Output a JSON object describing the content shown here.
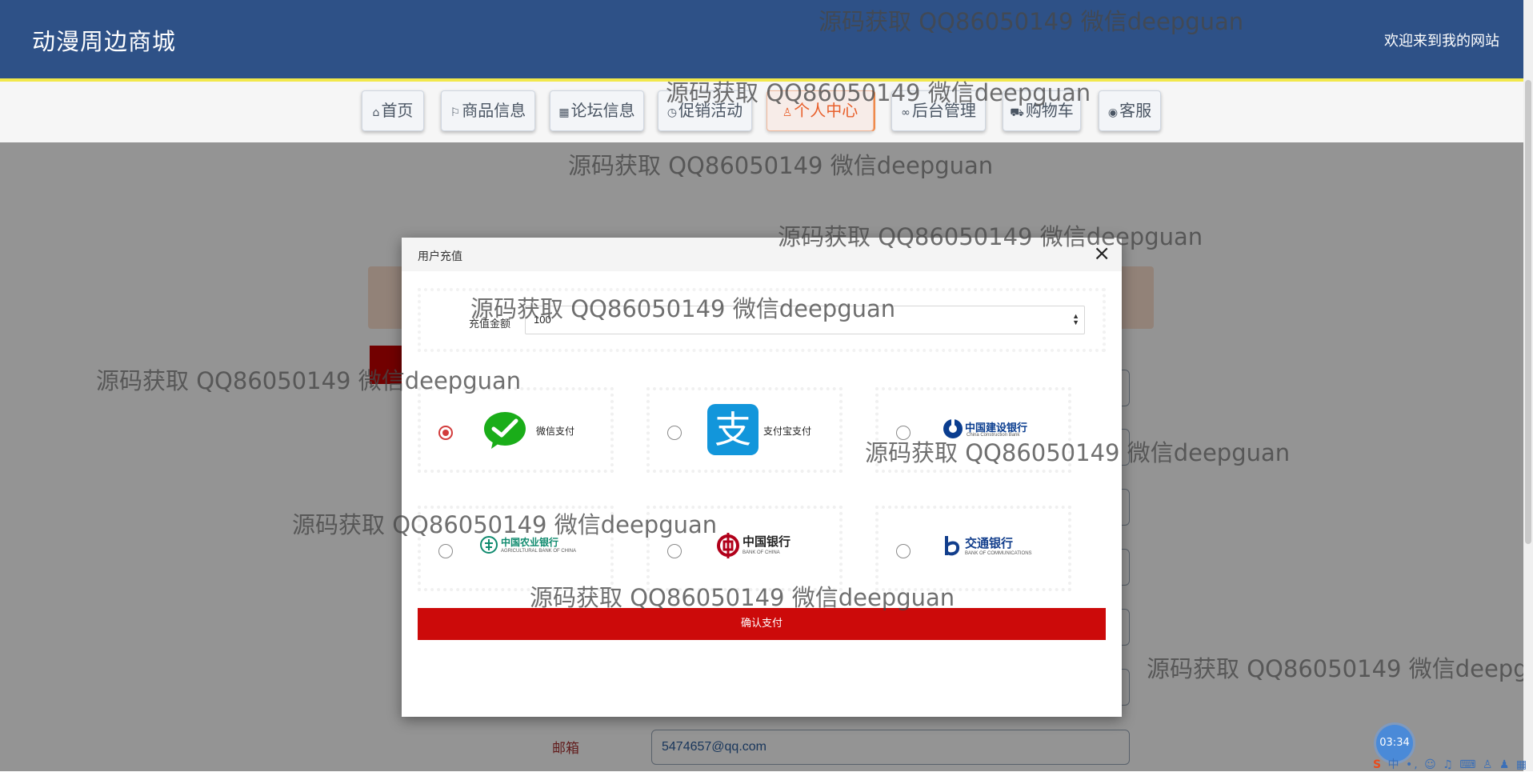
{
  "header": {
    "site_title": "动漫周边商城",
    "welcome": "欢迎来到我的网站"
  },
  "nav": {
    "items": [
      {
        "icon": "home-icon",
        "glyph": "⌂",
        "label": "首页"
      },
      {
        "icon": "flag-icon",
        "glyph": "⚐",
        "label": "商品信息"
      },
      {
        "icon": "forum-icon",
        "glyph": "▦",
        "label": "论坛信息"
      },
      {
        "icon": "clock-icon",
        "glyph": "◷",
        "label": "促销活动"
      },
      {
        "icon": "user-icon",
        "glyph": "♙",
        "label": "个人中心"
      },
      {
        "icon": "link-icon",
        "glyph": "∞",
        "label": "后台管理"
      },
      {
        "icon": "cart-icon",
        "glyph": "⛟",
        "label": "购物车"
      },
      {
        "icon": "headset-icon",
        "glyph": "◉",
        "label": "客服"
      }
    ],
    "active": "个人中心"
  },
  "profile_form": {
    "email_label": "邮箱",
    "email_value": "5474657@qq.com"
  },
  "modal": {
    "title": "用户充值",
    "close_glyph": "×",
    "amount_label": "充值金额",
    "amount_value": "100",
    "payment_options": [
      {
        "id": "wechat",
        "label": "微信支付",
        "icon": "wechat-pay-icon",
        "selected": true
      },
      {
        "id": "alipay",
        "label": "支付宝支付",
        "icon": "alipay-icon",
        "glyph": "支",
        "selected": false
      },
      {
        "id": "ccb",
        "label": "中国建设银行",
        "sub": "China Construction Bank",
        "icon": "ccb-logo",
        "selected": false
      },
      {
        "id": "abc",
        "label": "中国农业银行",
        "sub": "AGRICULTURAL BANK OF CHINA",
        "icon": "abc-logo",
        "selected": false
      },
      {
        "id": "boc",
        "label": "中国银行",
        "sub": "BANK OF CHINA",
        "icon": "boc-logo",
        "selected": false
      },
      {
        "id": "bocom",
        "label": "交通银行",
        "sub": "BANK OF COMMUNICATIONS",
        "icon": "bocom-logo",
        "selected": false
      }
    ],
    "confirm_label": "确认支付"
  },
  "watermark_text": "源码获取 QQ86050149 微信deepguan",
  "watermark_cut_text": "源码获取 QQ86050149 微信deepg",
  "timer": "03:34",
  "colors": {
    "header_bg": "#2e5187",
    "header_border": "#f2e84b",
    "confirm_button": "#cc0a0a",
    "active_nav": "#e8602c",
    "wechat_green": "#1aad19",
    "alipay_blue": "#1296db"
  }
}
